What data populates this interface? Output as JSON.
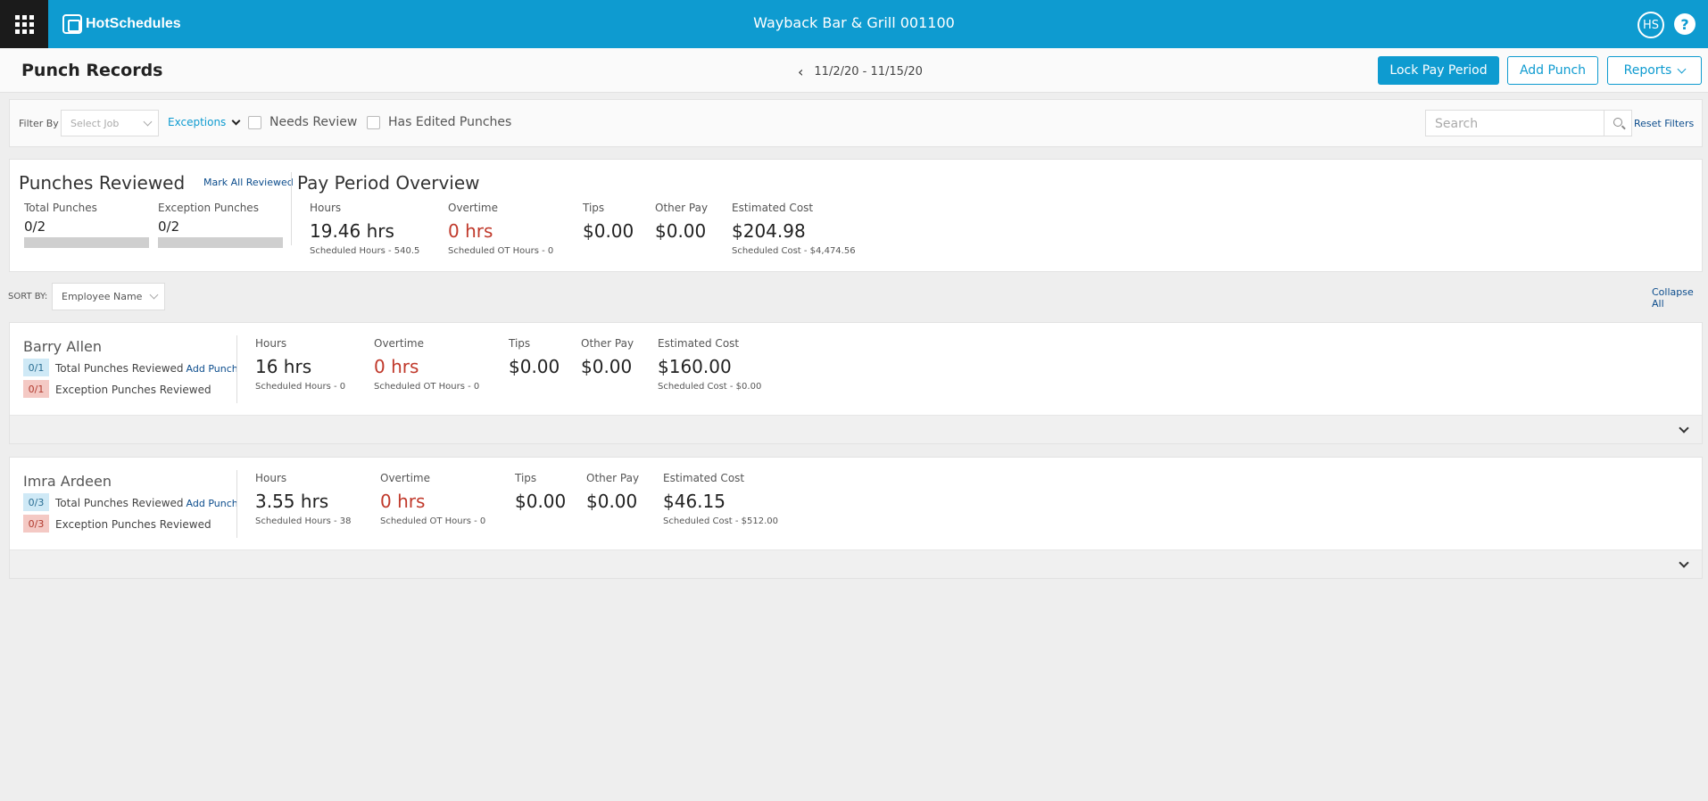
{
  "topbar": {
    "logo_text": "HotSchedules",
    "store_name": "Wayback Bar & Grill 001100",
    "avatar_initials": "HS",
    "help_symbol": "?"
  },
  "header": {
    "title": "Punch Records",
    "period": "11/2/20 - 11/15/20",
    "lock_label": "Lock Pay Period",
    "add_punch_label": "Add Punch",
    "reports_label": "Reports"
  },
  "filters": {
    "filter_by_label": "Filter By",
    "job_placeholder": "Select Job",
    "exceptions_label": "Exceptions",
    "needs_review_label": "Needs Review",
    "has_edited_label": "Has Edited Punches",
    "search_placeholder": "Search",
    "reset_label": "Reset Filters"
  },
  "reviewed": {
    "title": "Punches Reviewed",
    "mark_all": "Mark All Reviewed",
    "total_label": "Total Punches",
    "total_value": "0/2",
    "exception_label": "Exception Punches",
    "exception_value": "0/2"
  },
  "overview": {
    "title": "Pay Period Overview",
    "hours_label": "Hours",
    "hours_value": "19.46 hrs",
    "hours_sub": "Scheduled Hours - 540.5",
    "ot_label": "Overtime",
    "ot_value": "0 hrs",
    "ot_sub": "Scheduled OT Hours - 0",
    "tips_label": "Tips",
    "tips_value": "$0.00",
    "other_label": "Other Pay",
    "other_value": "$0.00",
    "cost_label": "Estimated Cost",
    "cost_value": "$204.98",
    "cost_sub": "Scheduled Cost - $4,474.56"
  },
  "sort": {
    "label": "SORT BY:",
    "value": "Employee Name",
    "collapse_all": "Collapse All"
  },
  "employees": [
    {
      "name": "Barry Allen",
      "total_badge": "0/1",
      "total_text": "Total Punches Reviewed",
      "add_punch": "Add Punch",
      "exception_badge": "0/1",
      "exception_text": "Exception Punches Reviewed",
      "hours_label": "Hours",
      "hours_value": "16 hrs",
      "hours_sub": "Scheduled Hours - 0",
      "ot_label": "Overtime",
      "ot_value": "0 hrs",
      "ot_sub": "Scheduled OT Hours - 0",
      "tips_label": "Tips",
      "tips_value": "$0.00",
      "other_label": "Other Pay",
      "other_value": "$0.00",
      "cost_label": "Estimated Cost",
      "cost_value": "$160.00",
      "cost_sub": "Scheduled Cost - $0.00"
    },
    {
      "name": "Imra Ardeen",
      "total_badge": "0/3",
      "total_text": "Total Punches Reviewed",
      "add_punch": "Add Punch",
      "exception_badge": "0/3",
      "exception_text": "Exception Punches Reviewed",
      "hours_label": "Hours",
      "hours_value": "3.55 hrs",
      "hours_sub": "Scheduled Hours - 38",
      "ot_label": "Overtime",
      "ot_value": "0 hrs",
      "ot_sub": "Scheduled OT Hours - 0",
      "tips_label": "Tips",
      "tips_value": "$0.00",
      "other_label": "Other Pay",
      "other_value": "$0.00",
      "cost_label": "Estimated Cost",
      "cost_value": "$46.15",
      "cost_sub": "Scheduled Cost - $512.00"
    }
  ],
  "colors": {
    "brand": "#0e9bd0",
    "dark": "#1b1b1b",
    "overtime_red": "#c0392b",
    "link_blue": "#0b4c8c"
  },
  "icons": [
    "apps-grid-icon",
    "logo-icon",
    "help-icon",
    "chevron-left-icon",
    "chevron-down-icon",
    "search-icon"
  ]
}
